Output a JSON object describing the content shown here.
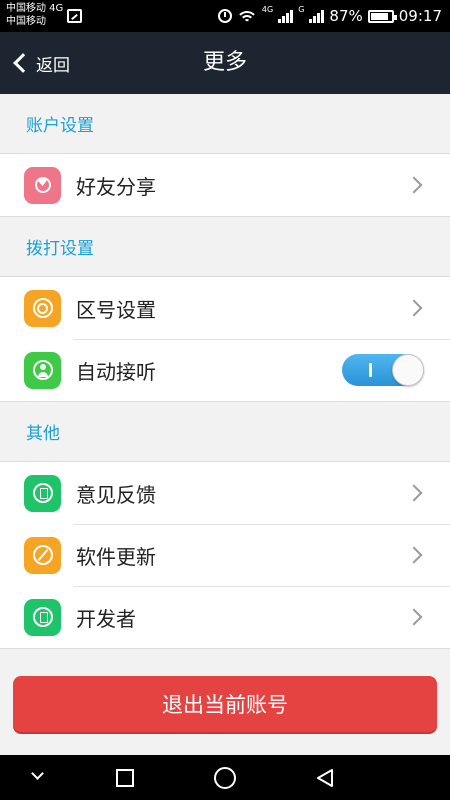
{
  "status_bar": {
    "carrier_1": "中国移动 4G",
    "carrier_2": "中国移动",
    "net_small_1": "4G",
    "net_small_2": "G",
    "battery": "87%",
    "time": "09:17",
    "battery_level": 0.87
  },
  "navbar": {
    "back_label": "返回",
    "title": "更多"
  },
  "sections": {
    "account": {
      "title": "账户设置",
      "items": [
        {
          "label": "好友分享",
          "icon": "heart-share-icon",
          "color": "#ef7588"
        }
      ]
    },
    "dial": {
      "title": "拨打设置",
      "items": [
        {
          "label": "区号设置",
          "icon": "target-icon",
          "color": "#f5a523"
        },
        {
          "label": "自动接听",
          "icon": "person-icon",
          "color": "#3ec947",
          "toggle": true
        }
      ]
    },
    "other": {
      "title": "其他",
      "items": [
        {
          "label": "意见反馈",
          "icon": "feedback-icon",
          "color": "#1ec36a"
        },
        {
          "label": "软件更新",
          "icon": "update-icon",
          "color": "#f5a523"
        },
        {
          "label": "开发者",
          "icon": "developer-icon",
          "color": "#1ec36a"
        }
      ]
    }
  },
  "logout_label": "退出当前账号",
  "accent_color": "#1aa0d6",
  "logout_color": "#e44342"
}
